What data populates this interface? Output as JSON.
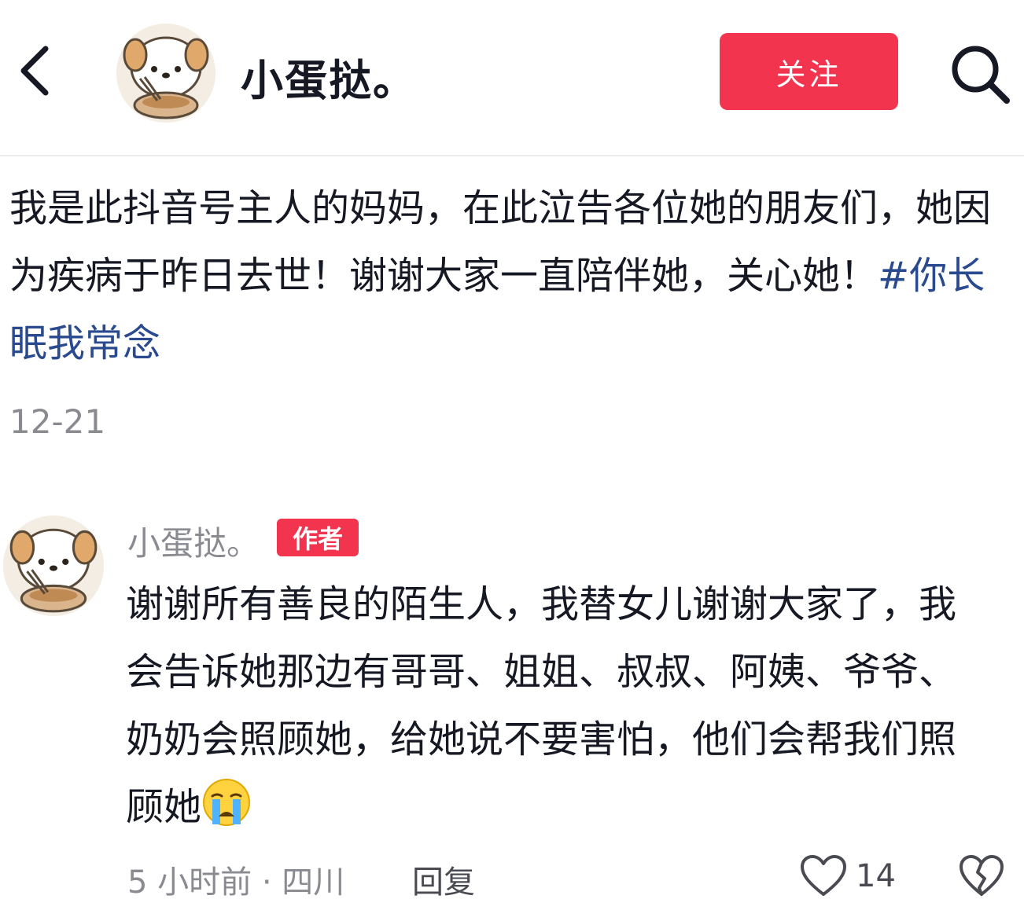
{
  "header": {
    "back_icon": "chevron-left-icon",
    "username": "小蛋挞。",
    "follow_label": "关注",
    "search_icon": "search-icon"
  },
  "post": {
    "text": "我是此抖音号主人的妈妈，在此泣告各位她的朋友们，她因为疾病于昨日去世！谢谢大家一直陪伴她，关心她！",
    "hashtag": "#你长眠我常念",
    "date": "12-21"
  },
  "comment": {
    "author": "小蛋挞。",
    "badge": "作者",
    "text": "谢谢所有善良的陌生人，我替女儿谢谢大家了，我会告诉她那边有哥哥、姐姐、叔叔、阿姨、爷爷、奶奶会照顾她，给她说不要害怕，他们会帮我们照顾她",
    "emoji": "crying-face-icon",
    "meta": "5 小时前 · 四川",
    "reply_label": "回复",
    "like_count": "14"
  },
  "colors": {
    "accent": "#f2344e",
    "hashtag": "#2a4a8f",
    "muted_text": "#8a8b91"
  }
}
